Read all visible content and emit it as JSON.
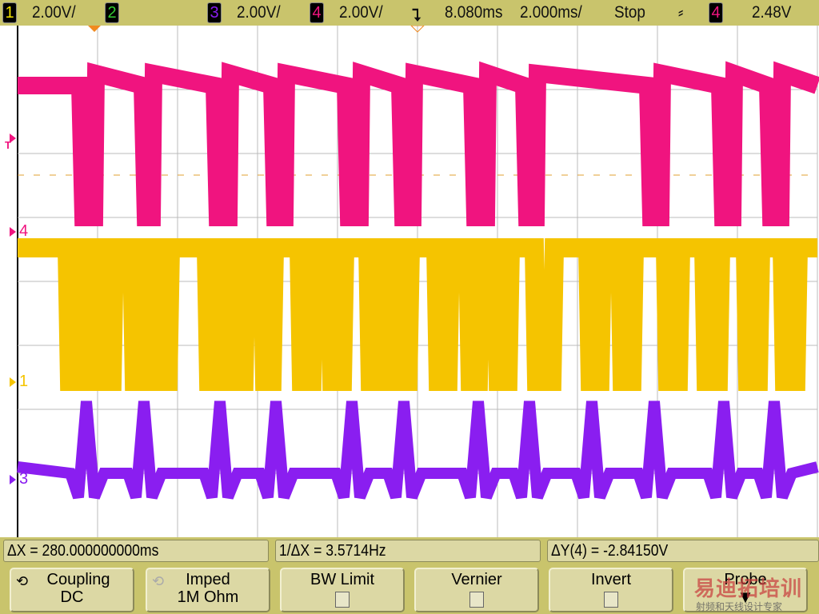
{
  "header": {
    "ch1": {
      "num": "1",
      "scale": "2.00V/",
      "color": "#f5c400"
    },
    "ch2": {
      "num": "2",
      "color": "#33cc33"
    },
    "ch3": {
      "num": "3",
      "scale": "2.00V/",
      "color": "#8a1ef0"
    },
    "ch4": {
      "num": "4",
      "scale": "2.00V/",
      "color": "#f0147f"
    },
    "delay": "8.080ms",
    "timebase": "2.000ms/",
    "run_state": "Stop",
    "trigger_slope_icon": "rising-edge-icon",
    "trigger_source": "4",
    "trigger_level": "2.48V"
  },
  "markers": {
    "trigger": "T",
    "ch4": "4",
    "ch1": "1",
    "ch3": "3"
  },
  "measurements": {
    "dx": "ΔX = 280.000000000ms",
    "inv_dx": "1/ΔX = 3.5714Hz",
    "dy": "ΔY(4) = -2.84150V"
  },
  "softkeys": [
    {
      "label": "Coupling",
      "value": "DC"
    },
    {
      "label": "Imped",
      "value": "1M Ohm"
    },
    {
      "label": "BW Limit",
      "checked": false
    },
    {
      "label": "Vernier",
      "checked": false
    },
    {
      "label": "Invert",
      "checked": false
    },
    {
      "label": "Probe"
    }
  ],
  "watermark": {
    "title": "易迪拓培训",
    "subtitle": "射频和天线设计专家"
  }
}
